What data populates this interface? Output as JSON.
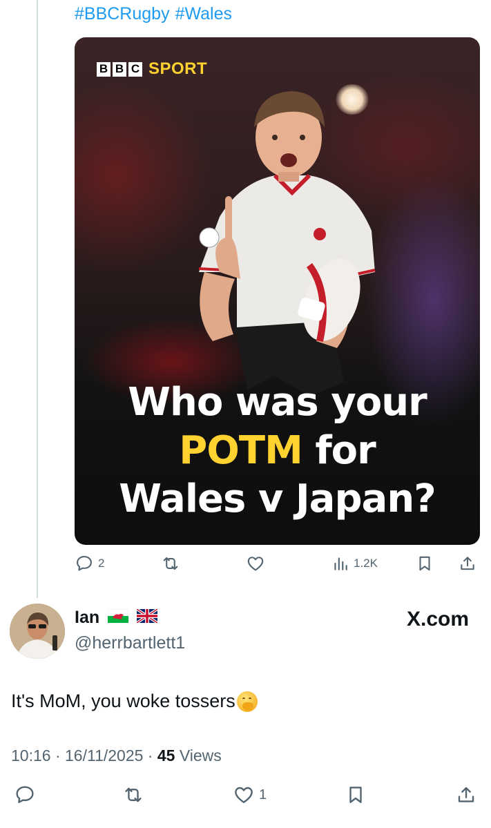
{
  "tweet": {
    "hashtags": [
      "#BBCRugby",
      "#Wales"
    ],
    "media": {
      "brand_box_letters": [
        "B",
        "B",
        "C"
      ],
      "brand_sport": "SPORT",
      "headline_line1": "Who was your",
      "headline_highlight": "POTM",
      "headline_line2_rest": "for",
      "headline_line3": "Wales v Japan?"
    },
    "actions": {
      "replies": "2",
      "views": "1.2K"
    }
  },
  "reply": {
    "name": "Ian",
    "flags": [
      "wales-flag",
      "uk-flag"
    ],
    "handle": "@herrbartlett1",
    "watermark": "X.com",
    "text": "It's MoM, you woke tossers",
    "emoji": "face-with-hand-over-mouth",
    "time": "10:16",
    "date": "16/11/2025",
    "views_count": "45",
    "views_label": "Views",
    "likes": "1"
  },
  "colors": {
    "link": "#1d9bf0",
    "muted": "#536471",
    "text": "#0f1419",
    "highlight": "#ffd230"
  }
}
